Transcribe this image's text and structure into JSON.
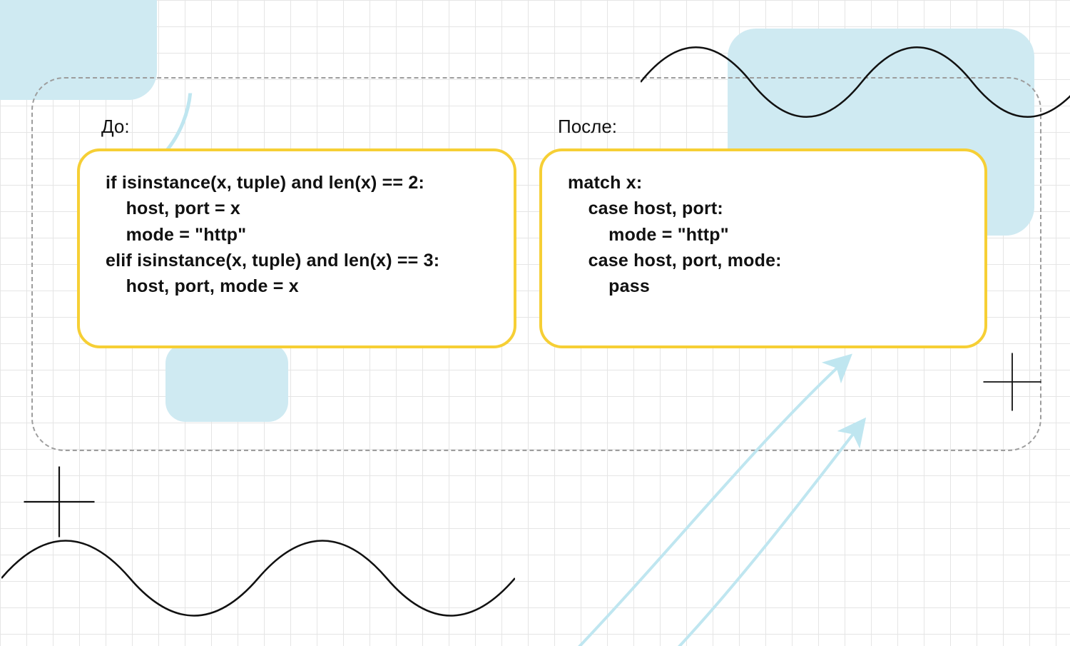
{
  "labels": {
    "before": "До:",
    "after": "После:"
  },
  "code": {
    "before": "if isinstance(x, tuple) and len(x) == 2:\n    host, port = x\n    mode = \"http\"\nelif isinstance(x, tuple) and len(x) == 3:\n    host, port, mode = x",
    "after": "match x:\n    case host, port:\n        mode = \"http\"\n    case host, port, mode:\n        pass"
  },
  "colors": {
    "grid": "#e5e5e5",
    "blob": "#cfeaf2",
    "border": "#f6cf35",
    "dash": "#9d9d9d",
    "ink": "#111111",
    "arrow": "#bfe6f0"
  }
}
